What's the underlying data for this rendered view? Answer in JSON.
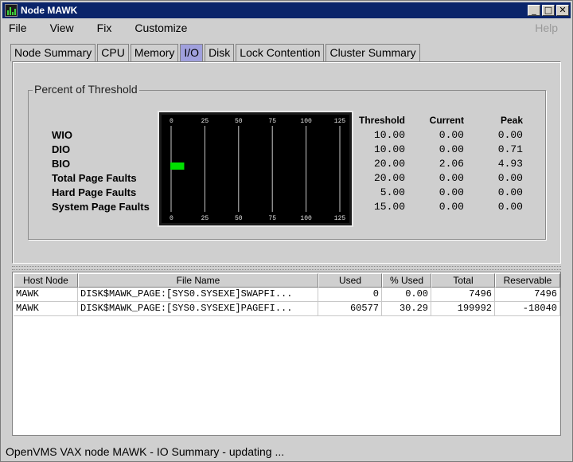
{
  "window": {
    "title": "Node MAWK",
    "controls": {
      "minimize": "_",
      "maximize": "□",
      "close": "✕"
    }
  },
  "menu": {
    "items": [
      "File",
      "View",
      "Fix",
      "Customize"
    ],
    "help": "Help"
  },
  "tabs": [
    "Node Summary",
    "CPU",
    "Memory",
    "I/O",
    "Disk",
    "Lock Contention",
    "Cluster Summary"
  ],
  "active_tab": "I/O",
  "threshold_panel": {
    "group_title": "Percent of Threshold",
    "columns": {
      "threshold": "Threshold",
      "current": "Current",
      "peak": "Peak"
    },
    "rows": [
      {
        "label": "WIO",
        "threshold": "10.00",
        "current": "0.00",
        "peak": "0.00"
      },
      {
        "label": "DIO",
        "threshold": "10.00",
        "current": "0.00",
        "peak": "0.71"
      },
      {
        "label": "BIO",
        "threshold": "20.00",
        "current": "2.06",
        "peak": "4.93"
      },
      {
        "label": "Total Page Faults",
        "threshold": "20.00",
        "current": "0.00",
        "peak": "0.00"
      },
      {
        "label": "Hard Page Faults",
        "threshold": "5.00",
        "current": "0.00",
        "peak": "0.00"
      },
      {
        "label": "System Page Faults",
        "threshold": "15.00",
        "current": "0.00",
        "peak": "0.00"
      }
    ]
  },
  "chart_data": {
    "type": "bar",
    "orientation": "horizontal",
    "categories": [
      "WIO",
      "DIO",
      "BIO",
      "Total Page Faults",
      "Hard Page Faults",
      "System Page Faults"
    ],
    "values": [
      0,
      0,
      10.3,
      0,
      0,
      0
    ],
    "xlim": [
      0,
      125
    ],
    "xticks": [
      "0",
      "25",
      "50",
      "75",
      "100",
      "125"
    ],
    "grid": true,
    "background": "#000000",
    "bar_color": "#00e000",
    "gridline_color": "#c8c8c8"
  },
  "files_table": {
    "columns": [
      "Host Node",
      "File Name",
      "Used",
      "% Used",
      "Total",
      "Reservable"
    ],
    "rows": [
      [
        "MAWK",
        "DISK$MAWK_PAGE:[SYS0.SYSEXE]SWAPFI...",
        "0",
        "0.00",
        "7496",
        "7496"
      ],
      [
        "MAWK",
        "DISK$MAWK_PAGE:[SYS0.SYSEXE]PAGEFI...",
        "60577",
        "30.29",
        "199992",
        "-18040"
      ]
    ]
  },
  "status": "OpenVMS VAX node MAWK - IO Summary - updating ...",
  "colors": {
    "titlebar": "#0a246a",
    "active_tab": "#a0a0dc",
    "window_bg": "#cfcfcf"
  }
}
